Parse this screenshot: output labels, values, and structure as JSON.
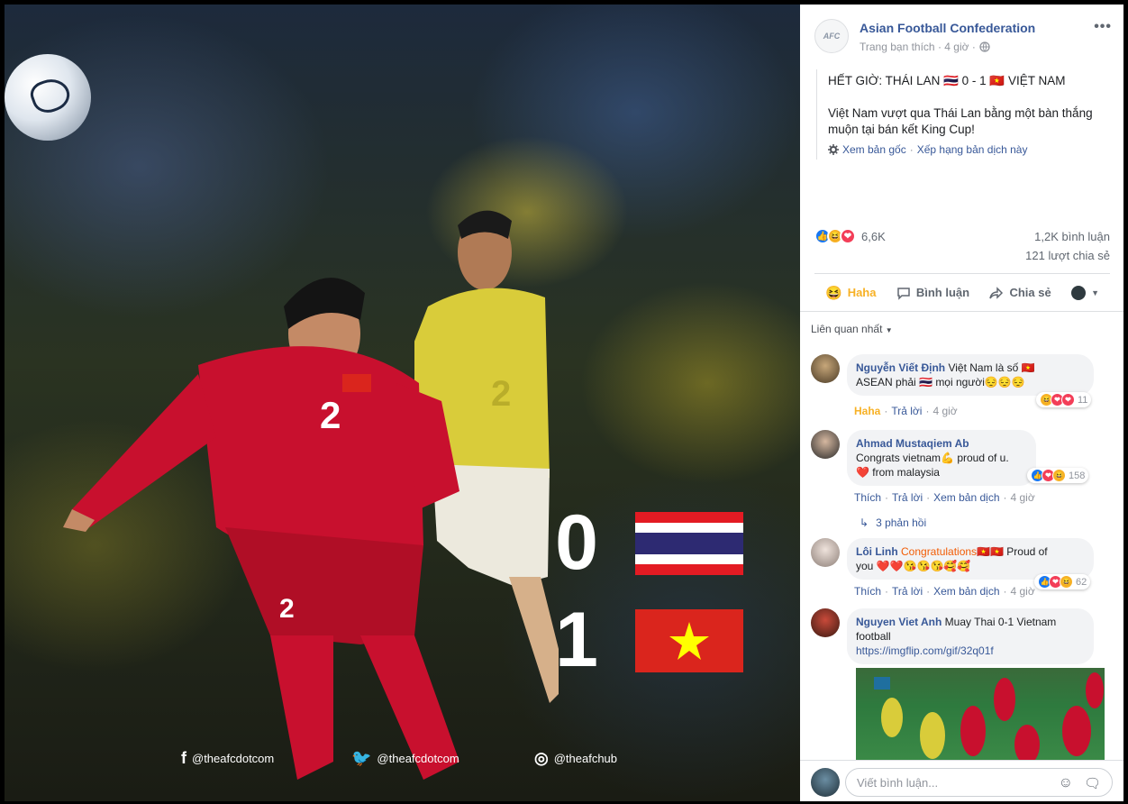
{
  "photo": {
    "score": [
      {
        "num": "0",
        "team": "Thái Lan",
        "flag": "thailand-flag"
      },
      {
        "num": "1",
        "team": "Việt Nam",
        "flag": "vietnam-flag"
      }
    ],
    "jersey_red": "2",
    "jersey_yellow": "2",
    "social": [
      {
        "icon": "facebook-icon",
        "glyph": "f",
        "handle": "@theafcdotcom"
      },
      {
        "icon": "twitter-icon",
        "glyph": "🐦",
        "handle": "@theafcdotcom"
      },
      {
        "icon": "instagram-icon",
        "glyph": "◎",
        "handle": "@theafchub"
      }
    ]
  },
  "post": {
    "page_name": "Asian Football Confederation",
    "page_logo": "AFC",
    "meta_text": "Trang bạn thích · 4 giờ ·",
    "headline": "HẾT GIỜ: THÁI LAN 🇹🇭 0 - 1 🇻🇳 VIỆT NAM",
    "body": "Việt Nam vượt qua Thái Lan bằng một bàn thắng muộn tại bán kết King Cup!",
    "see_original": "Xem bản gốc",
    "rate_translation": "Xếp hạng bản dịch này",
    "reaction_count": "6,6K",
    "comment_count": "1,2K bình luận",
    "share_count": "121 lượt chia sẻ",
    "actions": {
      "haha": "Haha",
      "comment": "Bình luận",
      "share": "Chia sẻ"
    },
    "sort_label": "Liên quan nhất"
  },
  "comments": [
    {
      "name": "Nguyễn Viết Định",
      "text_1": " Việt Nam là số 🇻🇳",
      "text_2": "ASEAN phải 🇹🇭 mọi người😔😔😔",
      "actions": {
        "react": "Haha",
        "reply": "Trả lời",
        "time": "4 giờ"
      },
      "react_count": "11"
    },
    {
      "name": "Ahmad Mustaqiem Ab",
      "text_1": "Congrats vietnam💪 proud of u.",
      "text_2": "❤️ from malaysia",
      "actions": {
        "react": "Thích",
        "reply": "Trả lời",
        "see": "Xem bản dịch",
        "time": "4 giờ"
      },
      "react_count": "158",
      "replies": "3 phản hồi"
    },
    {
      "name": "Lôi Linh",
      "highlight": "Congratulations",
      "text_1": "🇻🇳🇻🇳 Proud of",
      "text_2": "you ❤️❤️😘😘😘🥰🥰",
      "actions": {
        "react": "Thích",
        "reply": "Trả lời",
        "see": "Xem bản dịch",
        "time": "4 giờ"
      },
      "react_count": "62"
    },
    {
      "name": "Nguyen Viet Anh",
      "text_1": " Muay Thai 0-1 Vietnam",
      "text_2": "football",
      "link": "https://imgflip.com/gif/32q01f"
    }
  ],
  "composer": {
    "placeholder": "Viết bình luận..."
  },
  "colors": {
    "link": "#385898",
    "haha": "#f7b125",
    "like": "#1877f2",
    "love": "#f33e58",
    "red_jersey": "#c8102e",
    "yellow_jersey": "#d9cc3a"
  }
}
